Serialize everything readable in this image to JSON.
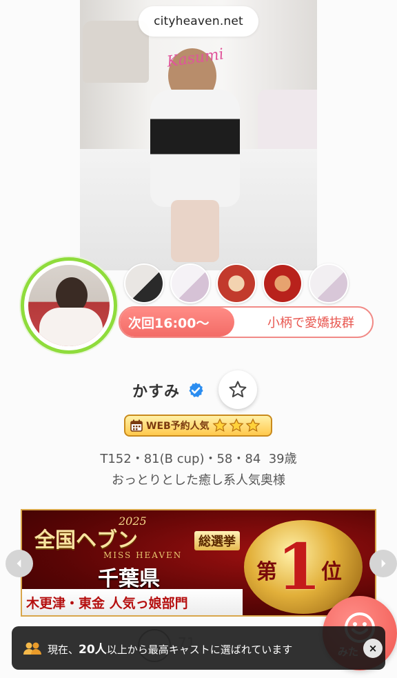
{
  "browser": {
    "domain": "cityheaven.net"
  },
  "photo": {
    "watermark": "Kasumi"
  },
  "thumbnails": [
    {
      "colors": [
        "#e9e6e3",
        "#2a2a2a"
      ]
    },
    {
      "colors": [
        "#f5f2f6",
        "#d6c2d6"
      ]
    },
    {
      "colors": [
        "#c23a2c",
        "#f3d3b0"
      ]
    },
    {
      "colors": [
        "#b8221c",
        "#e7a36f"
      ]
    },
    {
      "colors": [
        "#f2eff2",
        "#d8c7d8"
      ]
    }
  ],
  "schedule": {
    "next": "次回16:00〜",
    "catch_copy": "小柄で愛嬌抜群"
  },
  "profile": {
    "name": "かすみ",
    "badge": "WEB予約人気",
    "badge_stars": 3,
    "measurements": "T152・81(B cup)・58・84",
    "age": "39歳",
    "description": "おっとりとした癒し系人気奥様"
  },
  "banner": {
    "year": "2025",
    "national": "全国ヘブン",
    "election": "総選挙",
    "miss": "MISS HEAVEN",
    "prefecture": "千葉県",
    "category": "木更津・東金 人気っ娘部門",
    "rank_prefix": "第",
    "rank_number": "1",
    "rank_suffix": "位"
  },
  "floating": {
    "mitai_label": "みた",
    "behind_count": "71"
  },
  "toast": {
    "prefix": "現在、",
    "count": "20人",
    "suffix": "以上から最高キャストに選ばれています",
    "close": "×"
  },
  "colors": {
    "accent": "#f36b66",
    "ring": "#8fdc3c",
    "verified": "#2b8df0",
    "badge_border": "#c98a1c"
  }
}
